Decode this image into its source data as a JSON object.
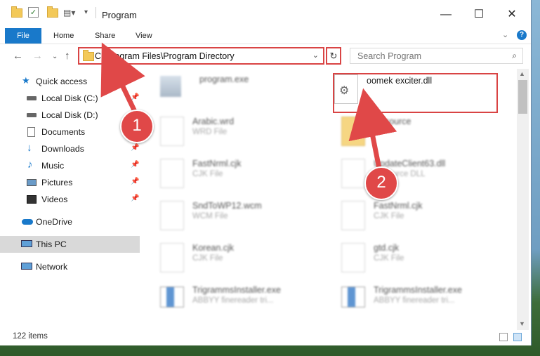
{
  "window": {
    "title": "Program",
    "controls": {
      "minimize": "—",
      "maximize": "☐",
      "close": "✕"
    }
  },
  "ribbon": {
    "tabs": [
      "File",
      "Home",
      "Share",
      "View"
    ],
    "help": "?"
  },
  "nav": {
    "address": "C:\\Program Files\\Program Directory",
    "search_placeholder": "Search Program"
  },
  "sidebar": {
    "items": [
      {
        "label": "Quick access",
        "icon": "star-icon"
      },
      {
        "label": "Local Disk (C:)",
        "icon": "drive-icon"
      },
      {
        "label": "Local Disk (D:)",
        "icon": "drive-icon"
      },
      {
        "label": "Documents",
        "icon": "documents-icon"
      },
      {
        "label": "Downloads",
        "icon": "download-icon"
      },
      {
        "label": "Music",
        "icon": "music-icon"
      },
      {
        "label": "Pictures",
        "icon": "pictures-icon"
      },
      {
        "label": "Videos",
        "icon": "videos-icon"
      },
      {
        "label": "OneDrive",
        "icon": "cloud-icon"
      },
      {
        "label": "This PC",
        "icon": "computer-icon"
      },
      {
        "label": "Network",
        "icon": "network-icon"
      }
    ]
  },
  "files": [
    {
      "name": "program.exe",
      "type": ""
    },
    {
      "name": "oomek exciter.dll",
      "type": ""
    },
    {
      "name": "Arabic.wrd",
      "type": "WRD File"
    },
    {
      "name": "Resource",
      "type": ""
    },
    {
      "name": "FastNrml.cjk",
      "type": "CJK File"
    },
    {
      "name": "UpdateClient63.dll",
      "type": "Resource DLL"
    },
    {
      "name": "SndToWP12.wcm",
      "type": "WCM File"
    },
    {
      "name": "FastNrml.cjk",
      "type": "CJK File"
    },
    {
      "name": "Korean.cjk",
      "type": "CJK File"
    },
    {
      "name": "gtd.cjk",
      "type": "CJK File"
    },
    {
      "name": "TrigrammsInstaller.exe",
      "type": "ABBYY finereader tri..."
    },
    {
      "name": "TrigrammsInstaller.exe",
      "type": "ABBYY finereader tri..."
    }
  ],
  "status": {
    "count": "122 items"
  },
  "badges": {
    "one": "1",
    "two": "2"
  },
  "colors": {
    "accent": "#1979ca",
    "highlight": "#d94444"
  }
}
